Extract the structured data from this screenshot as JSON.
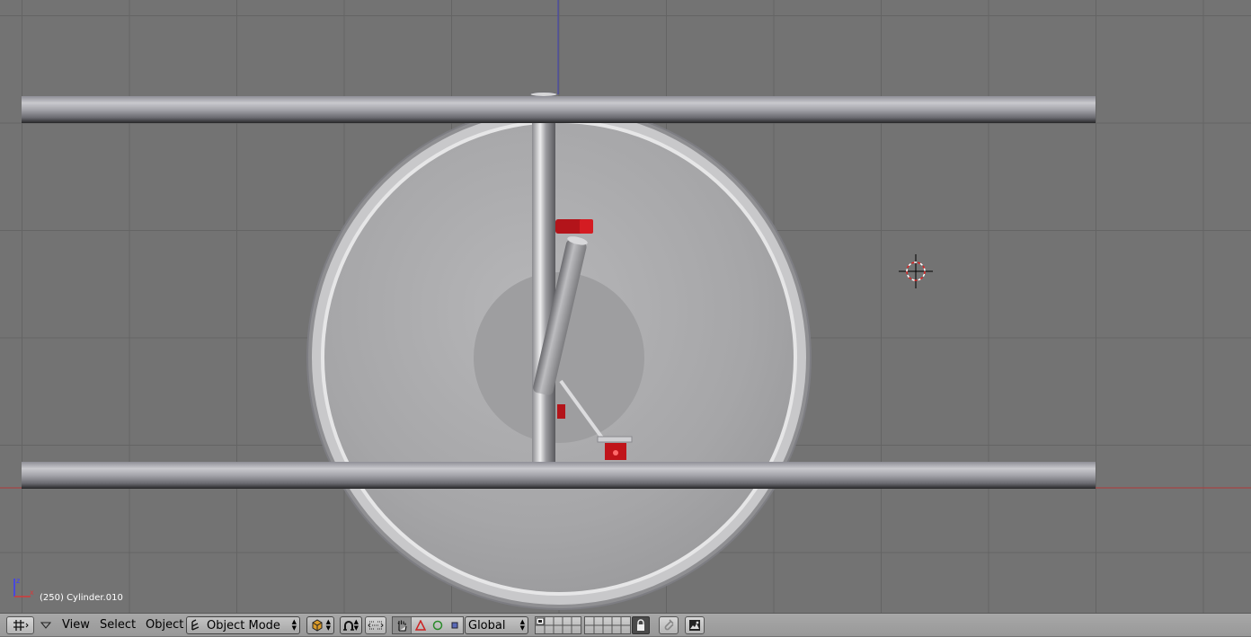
{
  "viewport": {
    "status_text": "(250) Cylinder.010",
    "axis_labels": {
      "x": "x",
      "z": "z"
    },
    "colors": {
      "grid_bg": "#737373",
      "grid_line": "#646464",
      "red_part": "#c0141a",
      "x_axis_line": "#b03a3a",
      "z_axis_line": "#3a3ab0"
    }
  },
  "header": {
    "editor_icon": "grid-icon",
    "menus": [
      "View",
      "Select",
      "Object"
    ],
    "mode": {
      "icon": "object-mode-icon",
      "label": "Object Mode"
    },
    "draw_type_icon": "shading-icon",
    "pivot_icon": "pivot-icon",
    "widget_icons": [
      "hand-icon",
      "translate-icon",
      "rotate-icon",
      "scale-icon"
    ],
    "orientation": "Global",
    "lock_icon": "lock-icon",
    "snap_icon": "magnet-icon",
    "render_icon": "render-icon"
  }
}
